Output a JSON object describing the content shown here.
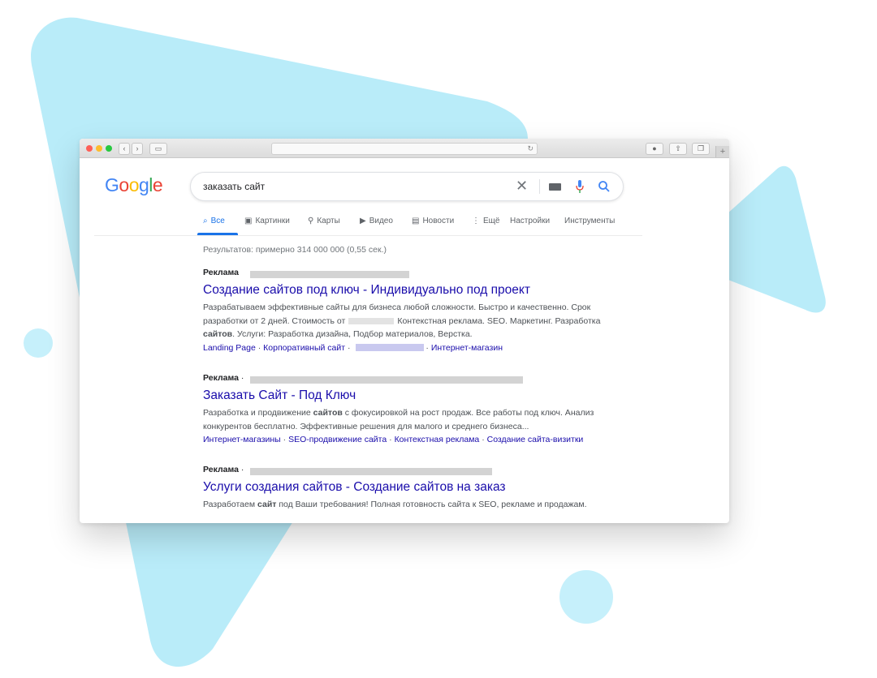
{
  "browser": {
    "accent_colors": {
      "red": "#fe5f57",
      "yellow": "#febc2e",
      "green": "#28c840"
    }
  },
  "google": {
    "logo_letters": [
      "G",
      "o",
      "o",
      "g",
      "l",
      "e"
    ],
    "search_query": "заказать сайт",
    "tabs": [
      {
        "label": "Все",
        "icon": "search-icon",
        "active": true
      },
      {
        "label": "Картинки",
        "icon": "image-icon",
        "active": false
      },
      {
        "label": "Карты",
        "icon": "map-pin-icon",
        "active": false
      },
      {
        "label": "Видео",
        "icon": "play-icon",
        "active": false
      },
      {
        "label": "Новости",
        "icon": "newspaper-icon",
        "active": false
      },
      {
        "label": "Ещё",
        "icon": "more-vert-icon",
        "active": false
      },
      {
        "label": "Настройки",
        "icon": "",
        "active": false
      },
      {
        "label": "Инструменты",
        "icon": "",
        "active": false
      }
    ],
    "stats": "Результатов: примерно 314 000 000 (0,55 сек.)",
    "ads": [
      {
        "badge": "Реклама",
        "title": "Создание сайтов под ключ - Индивидуально под проект",
        "desc_1": "Разрабатываем эффективные сайты для бизнеса любой сложности. Быстро и качественно. Срок разработки от 2 дней. Стоимость от",
        "desc_2": "Контекстная реклама. SEO. Маркетинг. Разработка",
        "desc_bold": "сайтов",
        "desc_3": ". Услуги: Разработка дизайна, Подбор материалов, Верстка.",
        "links": [
          "Landing Page",
          "Корпоративный сайт",
          "Интернет-магазин"
        ]
      },
      {
        "badge": "Реклама",
        "title": "Заказать Сайт - Под Ключ",
        "desc_1": "Разработка и продвижение",
        "desc_bold": "сайтов",
        "desc_2": "с фокусировкой на рост продаж. Все работы под ключ. Анализ конкурентов бесплатно. Эффективные решения для малого и среднего бизнеса...",
        "links": [
          "Интернет-магазины",
          "SEO-продвижение сайта",
          "Контекстная реклама",
          "Создание сайта-визитки"
        ]
      },
      {
        "badge": "Реклама",
        "title": "Услуги создания сайтов - Создание сайтов на заказ",
        "desc_1": "Разработаем",
        "desc_bold": "сайт",
        "desc_2": "под Ваши требования! Полная готовность сайта к SEO, рекламе и продажам."
      }
    ]
  }
}
